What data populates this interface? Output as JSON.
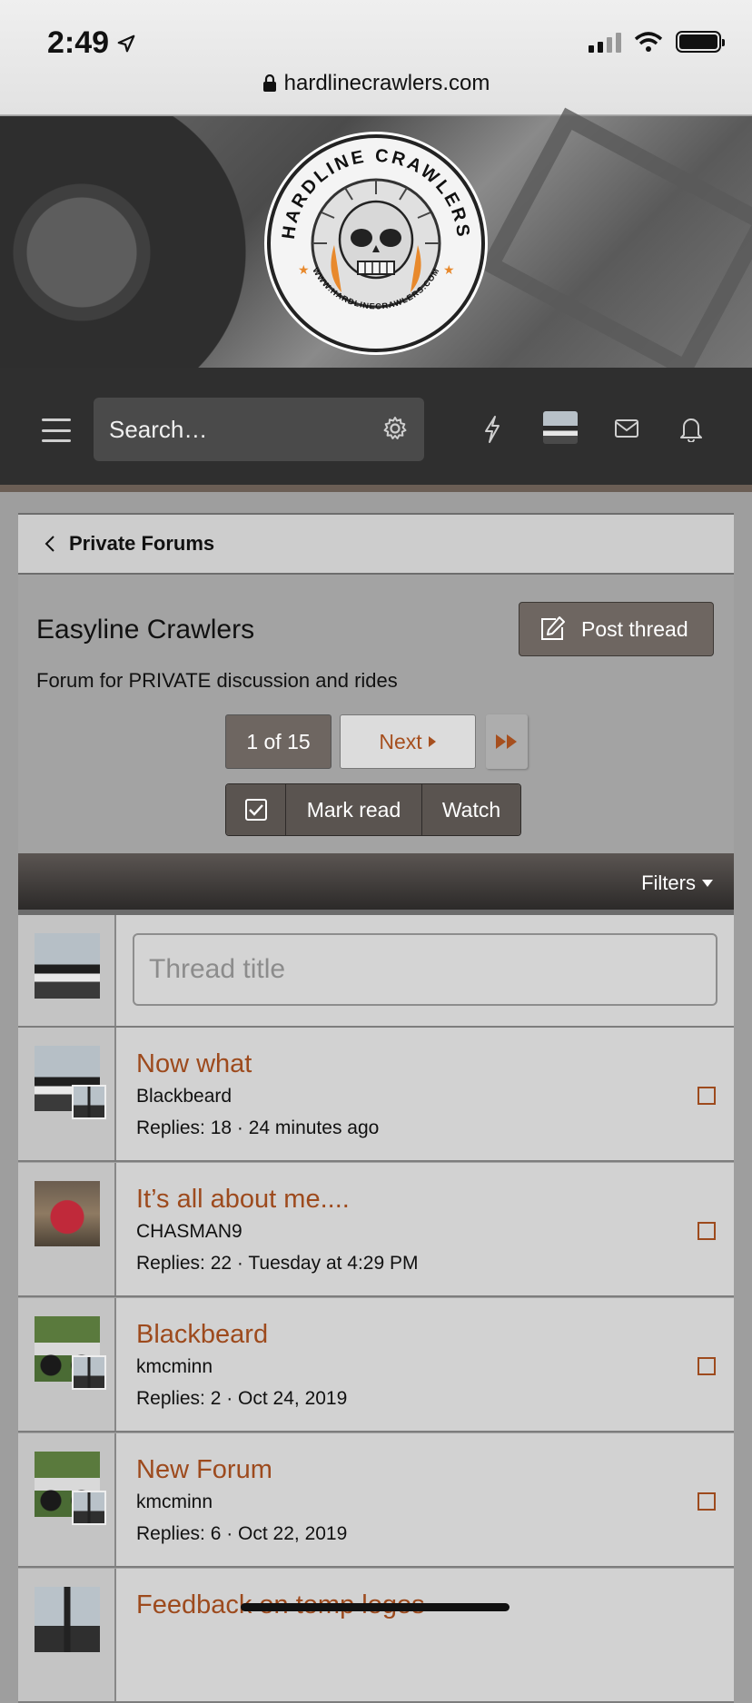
{
  "status": {
    "time": "2:49",
    "url": "hardlinecrawlers.com"
  },
  "logo": {
    "top_text": "HARDLINE CRAWLERS",
    "bottom_text": "WWW.HARDLINECRAWLERS.COM"
  },
  "nav": {
    "search_placeholder": "Search…"
  },
  "breadcrumb": {
    "label": "Private Forums"
  },
  "forum": {
    "title": "Easyline Crawlers",
    "description": "Forum for PRIVATE discussion and rides",
    "post_thread_label": "Post thread"
  },
  "pagination": {
    "current": "1 of 15",
    "next": "Next"
  },
  "actions": {
    "mark_read": "Mark read",
    "watch": "Watch"
  },
  "filters": {
    "label": "Filters"
  },
  "new_thread": {
    "placeholder": "Thread title"
  },
  "threads": [
    {
      "title": "Now what",
      "author": "Blackbeard",
      "meta": "Replies: 18 · 24 minutes ago"
    },
    {
      "title": "It’s all about me....",
      "author": "CHASMAN9",
      "meta": "Replies: 22 · Tuesday at 4:29 PM"
    },
    {
      "title": "Blackbeard",
      "author": "kmcminn",
      "meta": "Replies: 2 · Oct 24, 2019"
    },
    {
      "title": "New Forum",
      "author": "kmcminn",
      "meta": "Replies: 6 · Oct 22, 2019"
    },
    {
      "title": "Feedback on temp logos",
      "author": "",
      "meta": ""
    }
  ],
  "colors": {
    "accent": "#9d4a1d",
    "button_dark": "#6e6661",
    "nav_bg": "#2f2f2f"
  }
}
